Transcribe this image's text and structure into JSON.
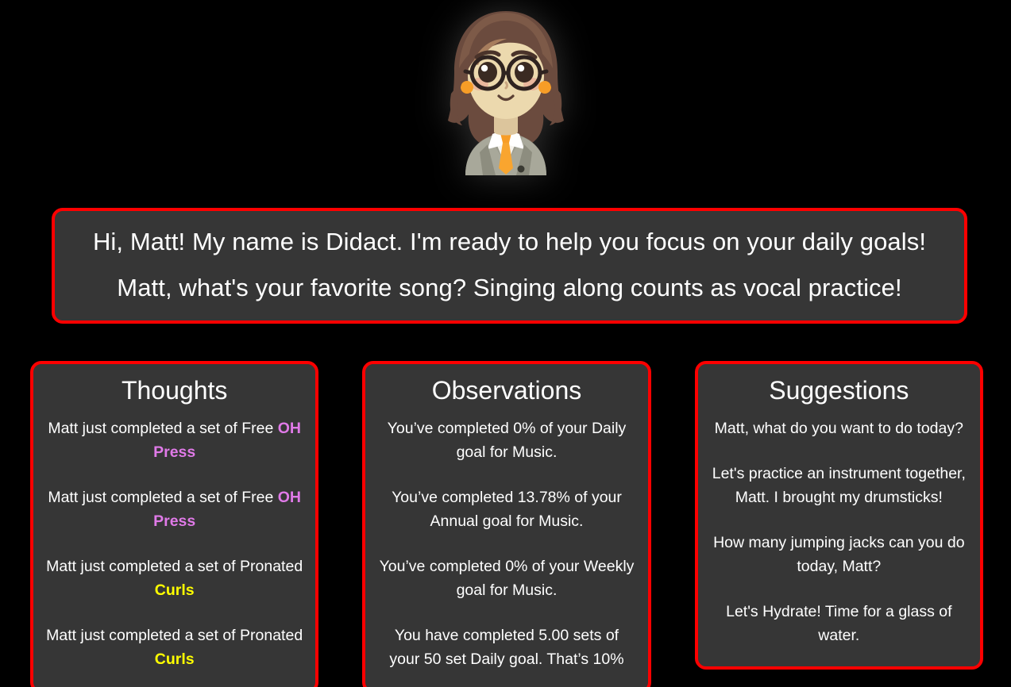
{
  "theme": {
    "page_background": "#000000",
    "card_background": "#363636",
    "card_border": "#ff0000",
    "text": "#ffffff",
    "keyword_violet": "#e07ae8",
    "keyword_yellow": "#ffff00"
  },
  "avatar": {
    "icon": "didact-avatar-icon",
    "description": "Cartoon woman with glasses, brown wavy hair, gray blazer and orange tie"
  },
  "banner": {
    "greeting": "Hi, Matt! My name is Didact. I'm ready to help you focus on your daily goals!",
    "prompt": "Matt, what's your favorite song? Singing along counts as vocal practice!"
  },
  "columns": [
    {
      "id": "thoughts",
      "title": "Thoughts",
      "entries": [
        {
          "prefix": "Matt just completed a set of Free ",
          "keyword": "OH Press",
          "keyword_style": "violet",
          "suffix": ""
        },
        {
          "prefix": "Matt just completed a set of Free ",
          "keyword": "OH Press",
          "keyword_style": "violet",
          "suffix": ""
        },
        {
          "prefix": "Matt just completed a set of Pronated ",
          "keyword": "Curls",
          "keyword_style": "yellow",
          "suffix": ""
        },
        {
          "prefix": "Matt just completed a set of Pronated ",
          "keyword": "Curls",
          "keyword_style": "yellow",
          "suffix": ""
        }
      ]
    },
    {
      "id": "observations",
      "title": "Observations",
      "entries": [
        {
          "prefix": "You’ve completed 0% of your Daily goal for Music.",
          "keyword": "",
          "keyword_style": "",
          "suffix": ""
        },
        {
          "prefix": "You’ve completed 13.78% of your Annual goal for Music.",
          "keyword": "",
          "keyword_style": "",
          "suffix": ""
        },
        {
          "prefix": "You’ve completed 0% of your Weekly goal for Music.",
          "keyword": "",
          "keyword_style": "",
          "suffix": ""
        },
        {
          "prefix": "You have completed 5.00 sets of your 50 set Daily goal. That’s 10%",
          "keyword": "",
          "keyword_style": "",
          "suffix": ""
        }
      ]
    },
    {
      "id": "suggestions",
      "title": "Suggestions",
      "entries": [
        {
          "prefix": "Matt, what do you want to do today?",
          "keyword": "",
          "keyword_style": "",
          "suffix": ""
        },
        {
          "prefix": "Let's practice an instrument together, Matt. I brought my drumsticks!",
          "keyword": "",
          "keyword_style": "",
          "suffix": ""
        },
        {
          "prefix": "How many jumping jacks can you do today, Matt?",
          "keyword": "",
          "keyword_style": "",
          "suffix": ""
        },
        {
          "prefix": "Let's Hydrate! Time for a glass of water.",
          "keyword": "",
          "keyword_style": "",
          "suffix": ""
        }
      ]
    }
  ]
}
